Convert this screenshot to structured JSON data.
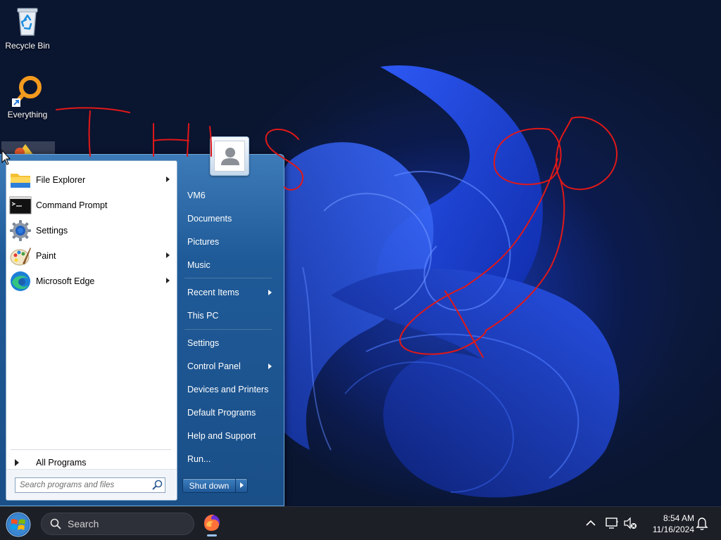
{
  "desktop": {
    "icons": [
      {
        "label": "Recycle Bin",
        "icon": "recycle-bin-icon"
      },
      {
        "label": "Everything",
        "icon": "everything-search-icon"
      }
    ],
    "annotation_text": "THIS"
  },
  "start_menu": {
    "pinned_programs": [
      {
        "label": "File Explorer",
        "icon": "folder-icon",
        "has_submenu": true
      },
      {
        "label": "Command Prompt",
        "icon": "command-prompt-icon",
        "has_submenu": false
      },
      {
        "label": "Settings",
        "icon": "gear-icon",
        "has_submenu": false
      },
      {
        "label": "Paint",
        "icon": "paint-icon",
        "has_submenu": true
      },
      {
        "label": "Microsoft Edge",
        "icon": "edge-icon",
        "has_submenu": true
      }
    ],
    "all_programs_label": "All Programs",
    "search_placeholder": "Search programs and files",
    "user_name": "VM6",
    "right_links": [
      {
        "label": "VM6",
        "has_submenu": false
      },
      {
        "label": "Documents",
        "has_submenu": false
      },
      {
        "label": "Pictures",
        "has_submenu": false
      },
      {
        "label": "Music",
        "has_submenu": false
      },
      {
        "label": "Recent Items",
        "has_submenu": true
      },
      {
        "label": "This PC",
        "has_submenu": false
      },
      {
        "label": "Settings",
        "has_submenu": false
      },
      {
        "label": "Control Panel",
        "has_submenu": true
      },
      {
        "label": "Devices and Printers",
        "has_submenu": false
      },
      {
        "label": "Default Programs",
        "has_submenu": false
      },
      {
        "label": "Help and Support",
        "has_submenu": false
      },
      {
        "label": "Run...",
        "has_submenu": false
      }
    ],
    "shutdown_label": "Shut down"
  },
  "taskbar": {
    "search_label": "Search",
    "pinned": [
      {
        "name": "Firefox",
        "icon": "firefox-icon",
        "running": true
      }
    ],
    "tray": {
      "time": "8:54 AM",
      "date": "11/16/2024"
    }
  },
  "colors": {
    "start_menu_blue": "#1f5a98",
    "taskbar": "#1c1f26",
    "annotation_red": "#e01818",
    "wallpaper_blue": "#1a3aa8"
  }
}
